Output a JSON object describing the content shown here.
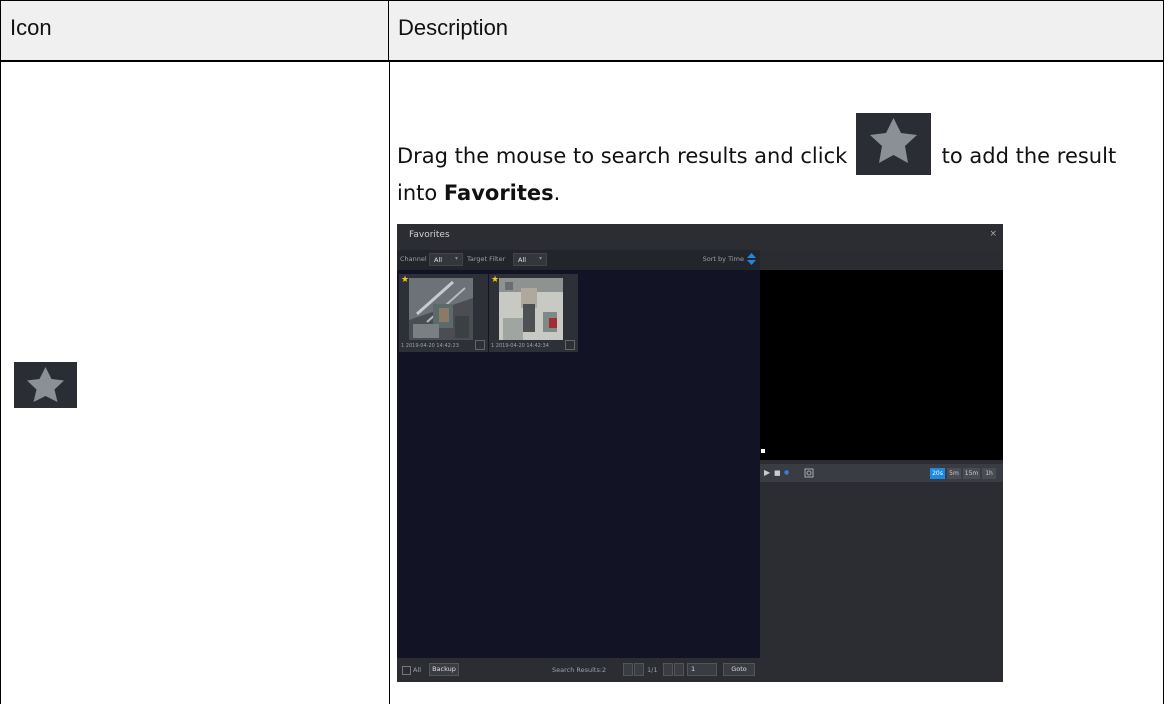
{
  "table": {
    "header_icon": "Icon",
    "header_description": "Description"
  },
  "row": {
    "icon": "favorite-star-icon",
    "text_before_icon": "Drag the mouse to search results and click",
    "text_after_icon": "to add the result into",
    "emphasis": "Favorites",
    "period": "."
  },
  "screenshot": {
    "title": "Favorites",
    "close": "×",
    "filters": {
      "channel_label": "Channel",
      "channel_value": "All",
      "target_filter_label": "Target Filter",
      "target_filter_value": "All",
      "sort_label": "Sort by Time"
    },
    "thumbnails": [
      {
        "timestamp": "1 2019-04-20 14:42:23",
        "favorite": "★"
      },
      {
        "timestamp": "1 2019-04-20 14:42:34",
        "favorite": "★"
      }
    ],
    "bottom": {
      "all_label": "All",
      "backup_label": "Backup",
      "search_results": "Search Results:2",
      "page_indicator": "1/1",
      "page_input": "1",
      "goto_label": "Goto"
    },
    "time_buttons": [
      "20s",
      "5m",
      "15m",
      "1h"
    ],
    "active_time_button": "20s",
    "colors": {
      "accent": "#1e88e5",
      "favorite_star": "#f5c518",
      "dark_bg": "#121426"
    }
  }
}
